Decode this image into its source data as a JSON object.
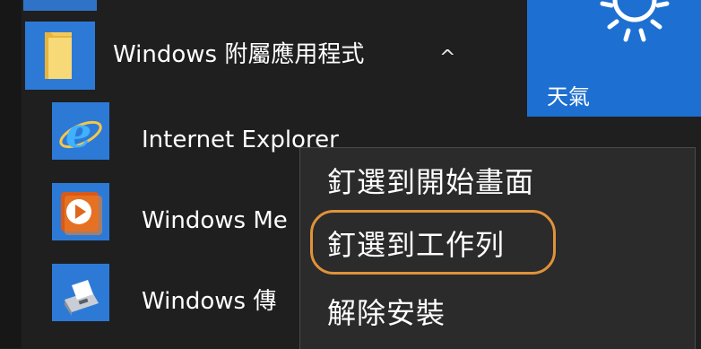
{
  "start_menu": {
    "folder": {
      "label": "Windows 附屬應用程式",
      "caret": "^"
    },
    "apps": [
      {
        "label": "Internet Explorer",
        "icon": "internet-explorer-icon"
      },
      {
        "label": "Windows Me",
        "icon": "windows-media-player-icon"
      },
      {
        "label": "Windows 傳",
        "icon": "windows-fax-scan-icon"
      }
    ]
  },
  "weather_tile": {
    "label": "天氣",
    "icon": "sun-icon"
  },
  "context_menu": {
    "items": [
      {
        "label": "釘選到開始畫面"
      },
      {
        "label": "釘選到工作列",
        "highlighted": true
      },
      {
        "label": "解除安裝"
      }
    ]
  },
  "colors": {
    "tile_blue": "#2d7ad6",
    "highlight_ring": "#e0923a",
    "menu_bg": "#2b2b2b"
  }
}
